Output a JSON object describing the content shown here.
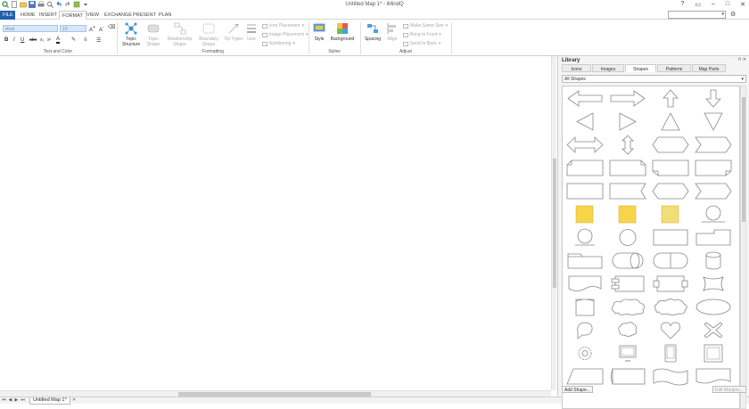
{
  "window": {
    "title": "Untitled Map 1* - iMindQ"
  },
  "menu_tabs": [
    {
      "label": "FILE"
    },
    {
      "label": "HOME"
    },
    {
      "label": "INSERT"
    },
    {
      "label": "FORMAT"
    },
    {
      "label": "VIEW"
    },
    {
      "label": "EXCHANGE"
    },
    {
      "label": "PRESENT"
    },
    {
      "label": "PLAN"
    }
  ],
  "ribbon": {
    "font_name": "Arial",
    "font_size": "10",
    "groups": {
      "text_and_color": "Text and Color",
      "formatting": "Formatting",
      "styles": "Styles",
      "adjust": "Adjust"
    },
    "buttons": {
      "topic_structure": "Topic Structure",
      "topic_shape": "Topic Shape",
      "relationship_shape": "Relationship Shape",
      "boundary_shape": "Boundary Shape",
      "tip_types": "Tip Types",
      "line": "Line",
      "icon_placement": "Icon Placement",
      "image_placement": "Image Placement",
      "numbering": "Numbering",
      "style": "Style",
      "background": "Background",
      "spacing": "Spacing",
      "align": "Align",
      "make_same_size": "Make Same Size",
      "bring_to_front": "Bring to Front",
      "send_to_back": "Send to Back"
    }
  },
  "library": {
    "title": "Library",
    "tabs": [
      {
        "label": "Icons"
      },
      {
        "label": "Images"
      },
      {
        "label": "Shapes",
        "active": true
      },
      {
        "label": "Patterns"
      },
      {
        "label": "Map Parts"
      }
    ],
    "filter": "All Shapes",
    "add_shape": "Add Shape...",
    "edit_margins": "Edit Margins..."
  },
  "sheet": {
    "tab_label": "Untitled Map 1*"
  },
  "colors": {
    "file_tab": "#1f5fae",
    "sticky_note": "#f7d54a"
  }
}
